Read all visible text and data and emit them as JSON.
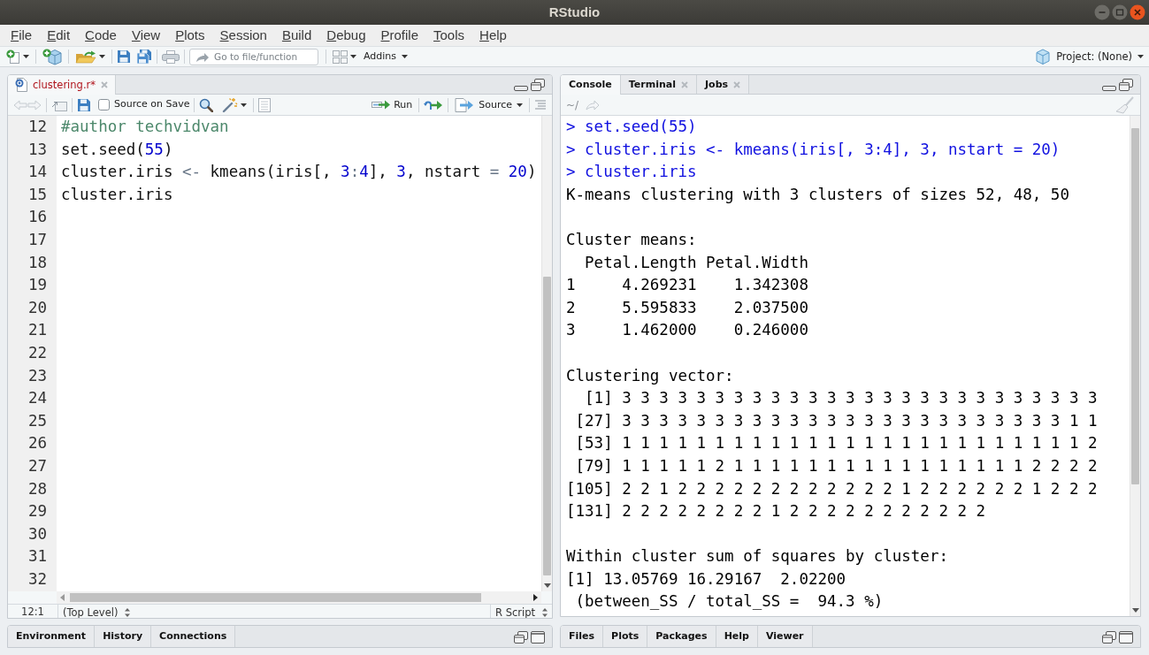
{
  "window": {
    "title": "RStudio"
  },
  "menu": [
    "File",
    "Edit",
    "Code",
    "View",
    "Plots",
    "Session",
    "Build",
    "Debug",
    "Profile",
    "Tools",
    "Help"
  ],
  "toolbar": {
    "goto": {
      "placeholder": "Go to file/function"
    },
    "addins": "Addins",
    "project": "Project: (None)"
  },
  "editor": {
    "tabs": [
      {
        "label": "clustering.r*",
        "selected": true,
        "modified": true,
        "closable": true
      }
    ],
    "source_on_save": {
      "label": "Source on Save",
      "checked": false
    },
    "run": "Run",
    "source": "Source",
    "lines": [
      {
        "number": "12",
        "tokens": [
          {
            "kind": "comment",
            "text": "#author techvidvan"
          }
        ]
      },
      {
        "number": "13",
        "tokens": [
          {
            "kind": "plain",
            "text": "set.seed("
          },
          {
            "kind": "number",
            "text": "55"
          },
          {
            "kind": "plain",
            "text": ")"
          }
        ]
      },
      {
        "number": "14",
        "tokens": [
          {
            "kind": "plain",
            "text": "cluster.iris "
          },
          {
            "kind": "operator",
            "text": "<-"
          },
          {
            "kind": "plain",
            "text": " kmeans(iris[, "
          },
          {
            "kind": "number",
            "text": "3"
          },
          {
            "kind": "operator",
            "text": ":"
          },
          {
            "kind": "number",
            "text": "4"
          },
          {
            "kind": "plain",
            "text": "], "
          },
          {
            "kind": "number",
            "text": "3"
          },
          {
            "kind": "plain",
            "text": ", nstart"
          },
          {
            "kind": "operator",
            "text": " = "
          },
          {
            "kind": "number",
            "text": "20"
          },
          {
            "kind": "plain",
            "text": ")"
          }
        ]
      },
      {
        "number": "15",
        "tokens": [
          {
            "kind": "plain",
            "text": "cluster.iris"
          }
        ]
      },
      {
        "number": "16"
      },
      {
        "number": "17"
      },
      {
        "number": "18"
      },
      {
        "number": "19"
      },
      {
        "number": "20"
      },
      {
        "number": "21"
      },
      {
        "number": "22"
      },
      {
        "number": "23"
      },
      {
        "number": "24"
      },
      {
        "number": "25"
      },
      {
        "number": "26"
      },
      {
        "number": "27"
      },
      {
        "number": "28"
      },
      {
        "number": "29"
      },
      {
        "number": "30"
      },
      {
        "number": "31"
      },
      {
        "number": "32"
      }
    ],
    "status": {
      "position": "12:1",
      "scope": "(Top Level)",
      "filetype": "R Script"
    }
  },
  "env_pane": {
    "tabs": [
      {
        "label": "Environment",
        "selected": false
      },
      {
        "label": "History",
        "selected": false
      },
      {
        "label": "Connections",
        "selected": false
      }
    ]
  },
  "console_pane": {
    "tabs": [
      {
        "label": "Console",
        "selected": true,
        "closable": false
      },
      {
        "label": "Terminal",
        "selected": false,
        "closable": true
      },
      {
        "label": "Jobs",
        "selected": false,
        "closable": true
      }
    ],
    "path": "~/",
    "lines": [
      {
        "kind": "input",
        "prompt": ">",
        "text": "set.seed(55)"
      },
      {
        "kind": "input",
        "prompt": ">",
        "text": "cluster.iris <- kmeans(iris[, 3:4], 3, nstart = 20)"
      },
      {
        "kind": "input",
        "prompt": ">",
        "text": "cluster.iris"
      },
      {
        "kind": "output",
        "text": "K-means clustering with 3 clusters of sizes 52, 48, 50"
      },
      {
        "kind": "blank"
      },
      {
        "kind": "output",
        "text": "Cluster means:"
      },
      {
        "kind": "output",
        "text": "  Petal.Length Petal.Width"
      },
      {
        "kind": "output",
        "text": "1     4.269231    1.342308"
      },
      {
        "kind": "output",
        "text": "2     5.595833    2.037500"
      },
      {
        "kind": "output",
        "text": "3     1.462000    0.246000"
      },
      {
        "kind": "blank"
      },
      {
        "kind": "output",
        "text": "Clustering vector:"
      },
      {
        "kind": "output",
        "text": "  [1] 3 3 3 3 3 3 3 3 3 3 3 3 3 3 3 3 3 3 3 3 3 3 3 3 3 3"
      },
      {
        "kind": "output",
        "text": " [27] 3 3 3 3 3 3 3 3 3 3 3 3 3 3 3 3 3 3 3 3 3 3 3 3 1 1"
      },
      {
        "kind": "output",
        "text": " [53] 1 1 1 1 1 1 1 1 1 1 1 1 1 1 1 1 1 1 1 1 1 1 1 1 1 2"
      },
      {
        "kind": "output",
        "text": " [79] 1 1 1 1 1 2 1 1 1 1 1 1 1 1 1 1 1 1 1 1 1 1 2 2 2 2"
      },
      {
        "kind": "output",
        "text": "[105] 2 2 1 2 2 2 2 2 2 2 2 2 2 2 2 1 2 2 2 2 2 2 1 2 2 2"
      },
      {
        "kind": "output",
        "text": "[131] 2 2 2 2 2 2 2 2 1 2 2 2 2 2 2 2 2 2 2 2"
      },
      {
        "kind": "blank"
      },
      {
        "kind": "output",
        "text": "Within cluster sum of squares by cluster:"
      },
      {
        "kind": "output",
        "text": "[1] 13.05769 16.29167  2.02200"
      },
      {
        "kind": "output",
        "text": " (between_SS / total_SS =  94.3 %)"
      }
    ]
  },
  "files_pane": {
    "tabs": [
      {
        "label": "Files",
        "selected": false
      },
      {
        "label": "Plots",
        "selected": false
      },
      {
        "label": "Packages",
        "selected": false
      },
      {
        "label": "Help",
        "selected": false
      },
      {
        "label": "Viewer",
        "selected": false
      }
    ]
  }
}
